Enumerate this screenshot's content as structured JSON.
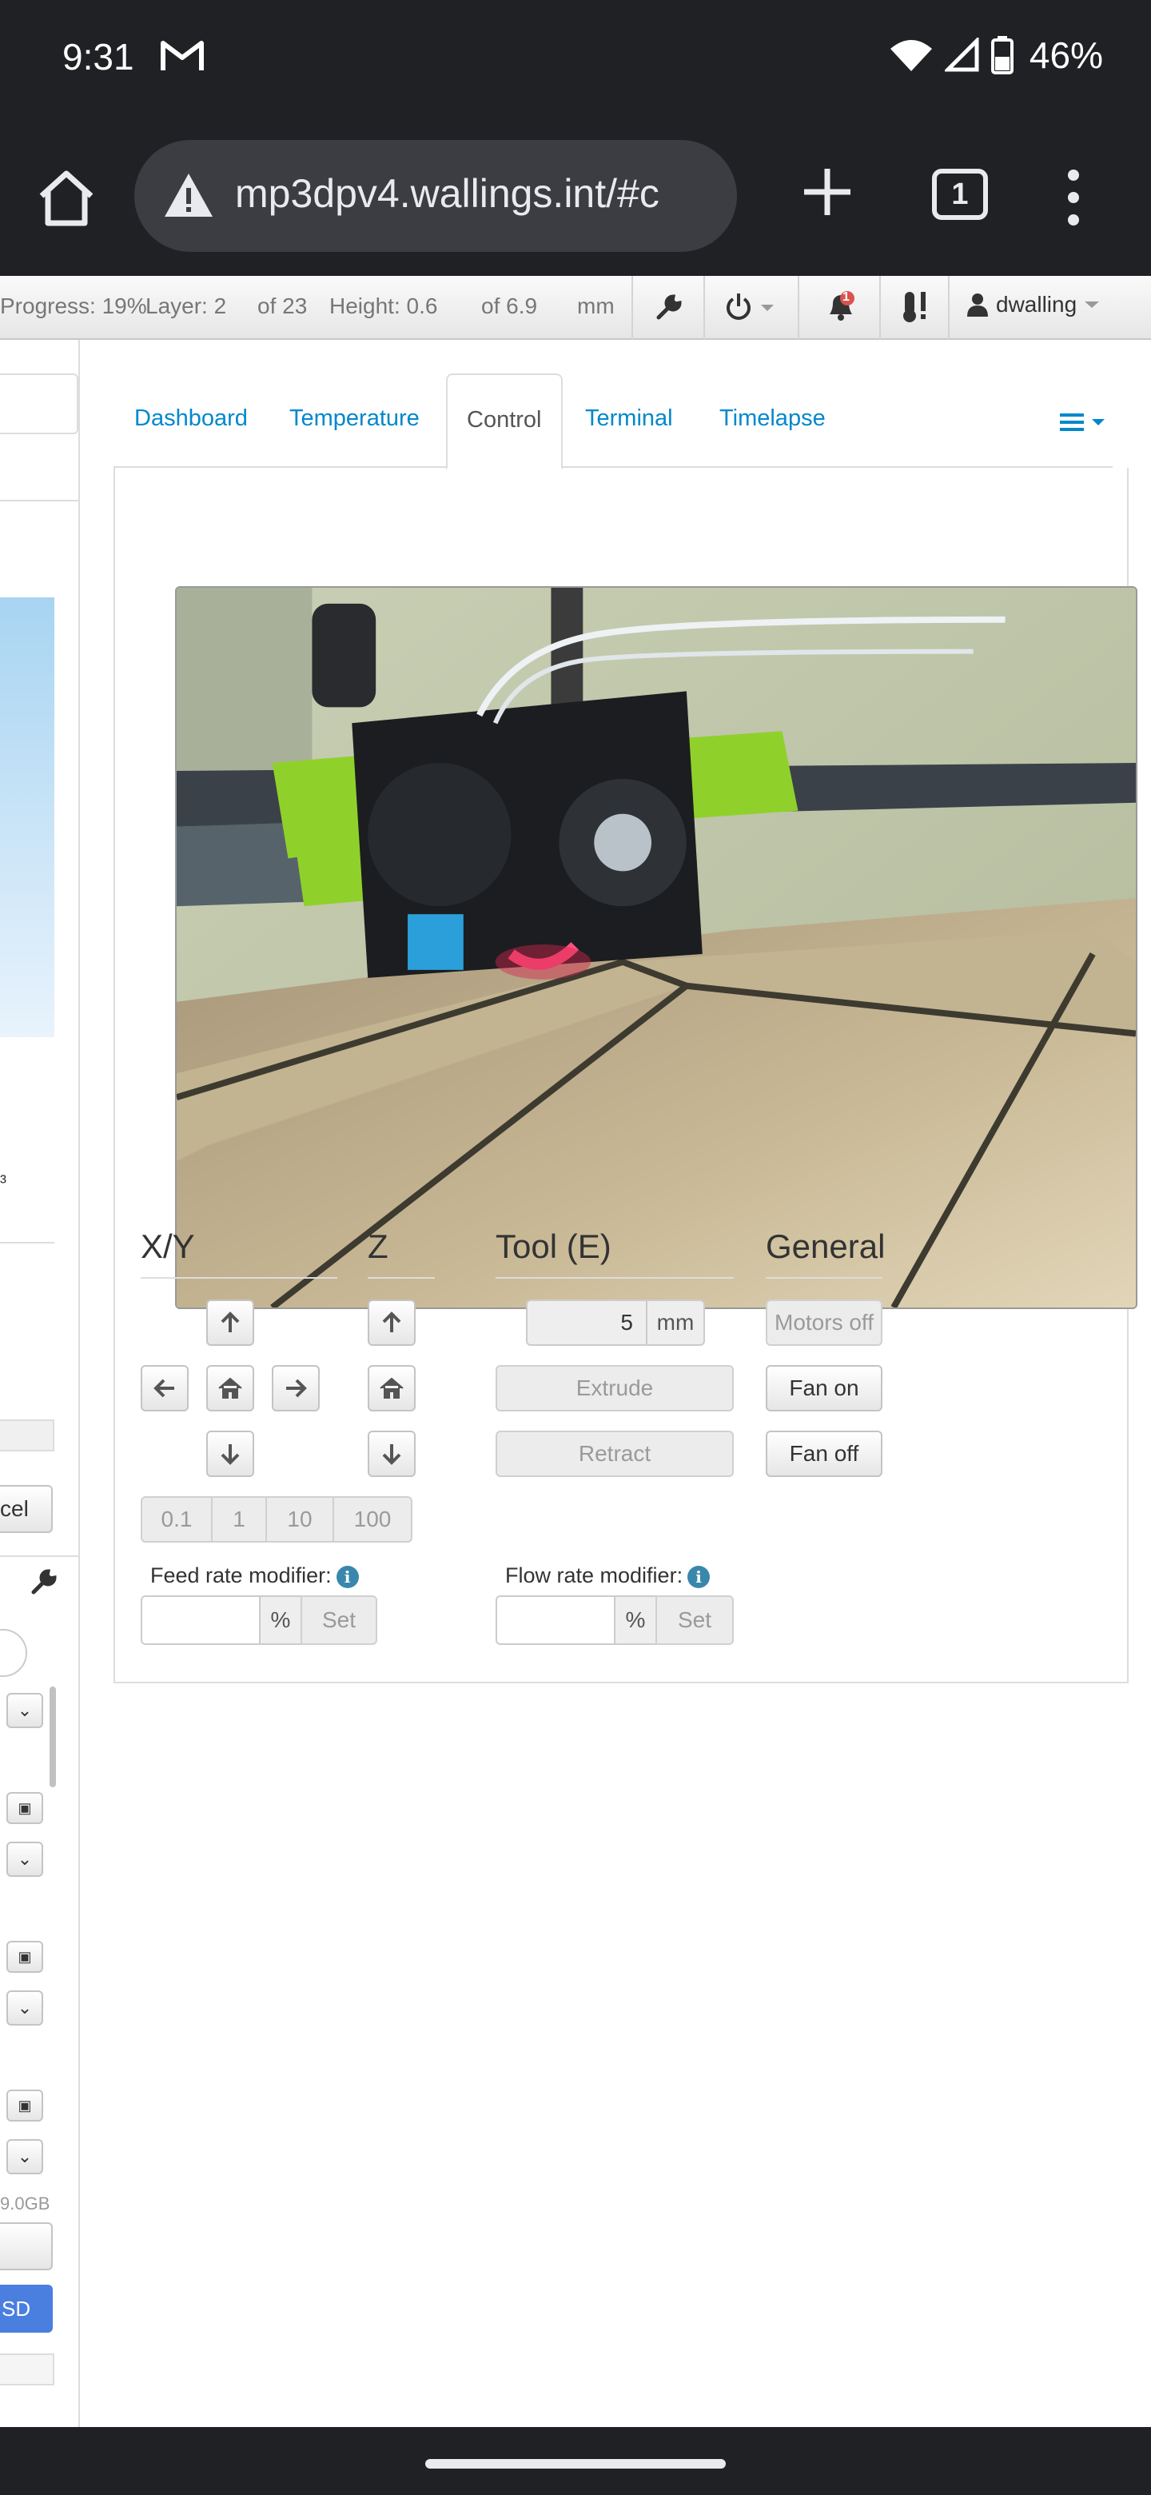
{
  "statusbar": {
    "time": "9:31",
    "battery": "46%"
  },
  "browser": {
    "url": "mp3dpv4.wallings.int/#c",
    "tab_count": "1"
  },
  "navbar": {
    "progress": "Progress: 19%",
    "layer": "Layer: 2",
    "layer_of": "of 23",
    "height": "Height: 0.6",
    "height_of": "of 6.9",
    "unit": "mm",
    "notification_count": "1",
    "user": "dwalling"
  },
  "sidebar": {
    "unit_fragment": "³",
    "cancel_fragment": "cel",
    "storage_fragment": "9.0GB",
    "sd_fragment": "SD"
  },
  "tabs": [
    "Dashboard",
    "Temperature",
    "Control",
    "Terminal",
    "Timelapse"
  ],
  "active_tab": "Control",
  "control": {
    "xy_title": "X/Y",
    "z_title": "Z",
    "tool_title": "Tool (E)",
    "general_title": "General",
    "step_options": [
      "0.1",
      "1",
      "10",
      "100"
    ],
    "extrude_amount": "5",
    "extrude_unit": "mm",
    "extrude_label": "Extrude",
    "retract_label": "Retract",
    "motors_off_label": "Motors off",
    "fan_on_label": "Fan on",
    "fan_off_label": "Fan off",
    "feed_rate_label": "Feed rate modifier:",
    "flow_rate_label": "Flow rate modifier:",
    "percent": "%",
    "set_label": "Set"
  },
  "colors": {
    "accent": "#0088cc",
    "info": "#3a87ad",
    "chrome": "#202124",
    "sd_button": "#4a7fe0"
  }
}
